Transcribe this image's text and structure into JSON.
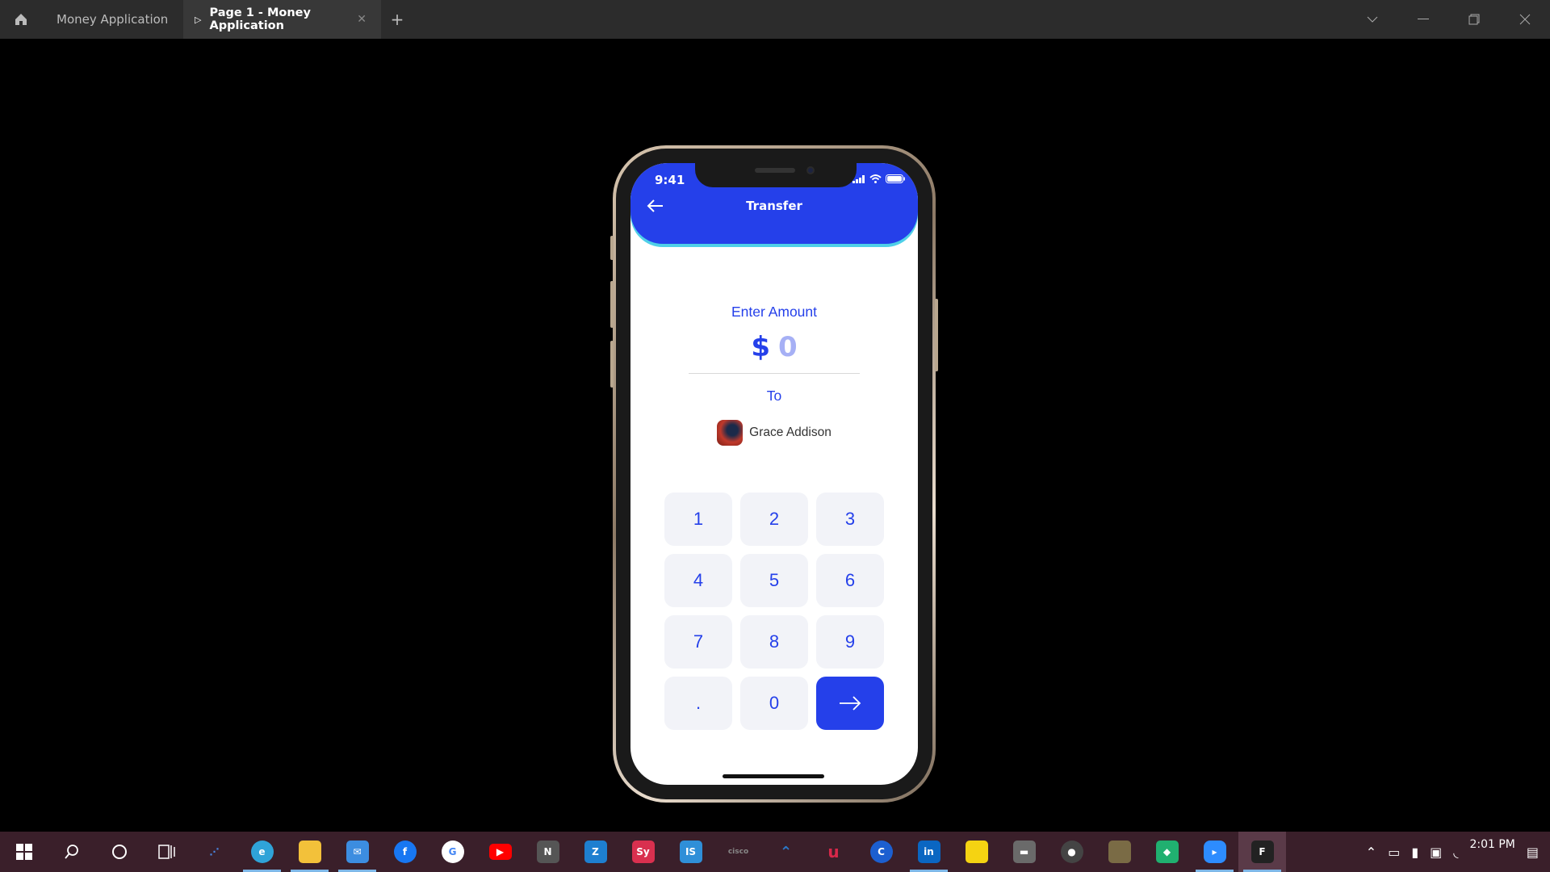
{
  "titlebar": {
    "tabs": [
      {
        "label": "Money Application"
      },
      {
        "label": "Page 1 - Money Application"
      }
    ]
  },
  "phone": {
    "status_time": "9:41",
    "header_title": "Transfer",
    "enter_label": "Enter Amount",
    "currency": "$",
    "amount": "0",
    "to_label": "To",
    "recipient_name": "Grace Addison",
    "keys": [
      "1",
      "2",
      "3",
      "4",
      "5",
      "6",
      "7",
      "8",
      "9",
      ".",
      "0"
    ]
  },
  "taskbar": {
    "time": "2:01 PM",
    "apps": [
      {
        "name": "start",
        "color": "#ffffff"
      },
      {
        "name": "search",
        "color": "#ffffff"
      },
      {
        "name": "cortana",
        "color": "#ffffff"
      },
      {
        "name": "task-view",
        "color": "#ffffff"
      },
      {
        "name": "visual-studio",
        "color": "#3f7fd8"
      },
      {
        "name": "edge",
        "color": "#2fa3d8"
      },
      {
        "name": "file-explorer",
        "color": "#f3c13a"
      },
      {
        "name": "mail",
        "color": "#3c8de0"
      },
      {
        "name": "facebook",
        "color": "#1877f2"
      },
      {
        "name": "google",
        "color": "#ffffff"
      },
      {
        "name": "youtube",
        "color": "#ff0000"
      },
      {
        "name": "notion",
        "color": "#555555"
      },
      {
        "name": "zoho",
        "color": "#1e7fd0"
      },
      {
        "name": "sy",
        "color": "#d9304f"
      },
      {
        "name": "is",
        "color": "#2f8fd8"
      },
      {
        "name": "cisco",
        "color": "#6a6a6a"
      },
      {
        "name": "arrow-app",
        "color": "#2b79c9"
      },
      {
        "name": "u-app",
        "color": "#d8284a"
      },
      {
        "name": "c-app",
        "color": "#1c5fd0"
      },
      {
        "name": "linkedin",
        "color": "#0a66c2"
      },
      {
        "name": "sticky-notes",
        "color": "#f5d312"
      },
      {
        "name": "calc",
        "color": "#6a6a6a"
      },
      {
        "name": "github",
        "color": "#444444"
      },
      {
        "name": "gallery",
        "color": "#7a6b45"
      },
      {
        "name": "kite",
        "color": "#20b070"
      },
      {
        "name": "zoom",
        "color": "#2d8cff"
      },
      {
        "name": "figma",
        "color": "#222222"
      }
    ]
  }
}
